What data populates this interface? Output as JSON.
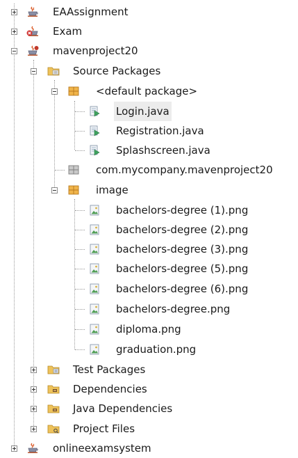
{
  "tree": {
    "projects": [
      {
        "label": "EAAssignment",
        "icon": "java-cup-icon",
        "expanded": false
      },
      {
        "label": "Exam",
        "icon": "java-cup-error-icon",
        "expanded": false
      },
      {
        "label": "mavenproject20",
        "icon": "maven-project-icon",
        "expanded": true
      },
      {
        "label": "onlineexamsystem",
        "icon": "java-cup-icon",
        "expanded": false
      }
    ],
    "source_packages": {
      "label": "Source Packages",
      "icon": "source-folder-icon",
      "expanded": true
    },
    "default_package": {
      "label": "<default package>",
      "icon": "package-icon",
      "expanded": true
    },
    "java_files": [
      {
        "label": "Login.java",
        "icon": "java-file-icon",
        "selected": true
      },
      {
        "label": "Registration.java",
        "icon": "java-file-icon",
        "selected": false
      },
      {
        "label": "Splashscreen.java",
        "icon": "java-file-icon",
        "selected": false
      }
    ],
    "company_package": {
      "label": "com.mycompany.mavenproject20",
      "icon": "empty-package-icon"
    },
    "image_package": {
      "label": "image",
      "icon": "package-icon",
      "expanded": true
    },
    "image_files": [
      {
        "label": "bachelors-degree (1).png",
        "icon": "image-file-icon"
      },
      {
        "label": "bachelors-degree (2).png",
        "icon": "image-file-icon"
      },
      {
        "label": "bachelors-degree (3).png",
        "icon": "image-file-icon"
      },
      {
        "label": "bachelors-degree (5).png",
        "icon": "image-file-icon"
      },
      {
        "label": "bachelors-degree (6).png",
        "icon": "image-file-icon"
      },
      {
        "label": "bachelors-degree.png",
        "icon": "image-file-icon"
      },
      {
        "label": "diploma.png",
        "icon": "image-file-icon"
      },
      {
        "label": "graduation.png",
        "icon": "image-file-icon"
      }
    ],
    "project_nodes": [
      {
        "label": "Test Packages",
        "icon": "test-folder-icon",
        "expanded": false
      },
      {
        "label": "Dependencies",
        "icon": "dependencies-folder-icon",
        "expanded": false
      },
      {
        "label": "Java Dependencies",
        "icon": "java-dependencies-folder-icon",
        "expanded": false
      },
      {
        "label": "Project Files",
        "icon": "project-files-folder-icon",
        "expanded": false
      }
    ]
  },
  "colors": {
    "selection": "#ececec",
    "folder": "#e6b84a",
    "package": "#e2a23a",
    "java_file": "#3a8a5a",
    "image_file": "#5aa05a",
    "maven": "#b8552e"
  }
}
